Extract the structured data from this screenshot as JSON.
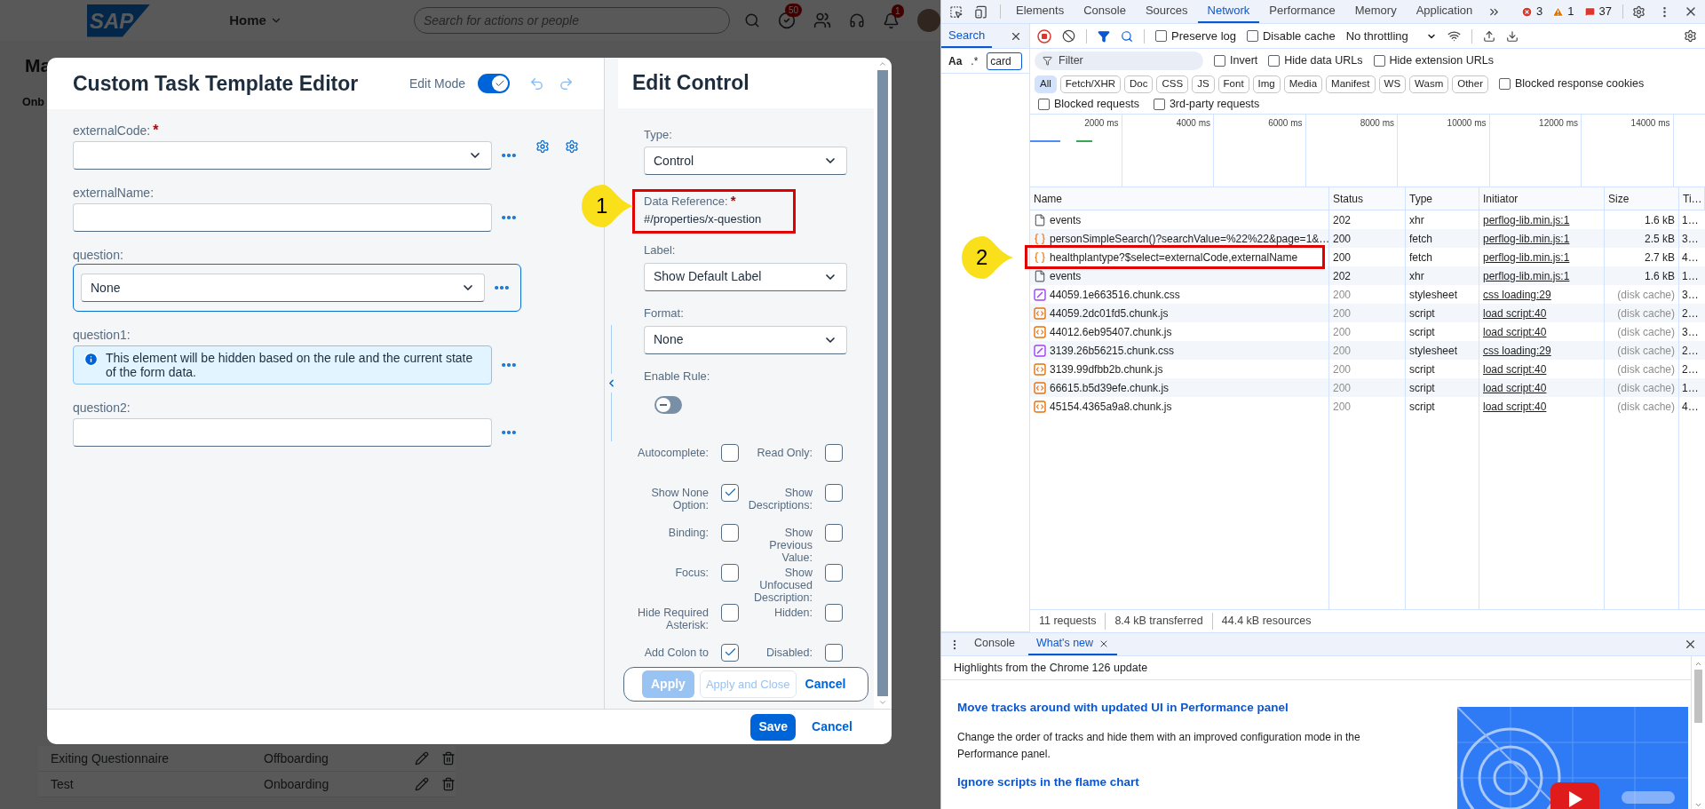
{
  "app": {
    "logo": "SAP",
    "nav": "Home",
    "search_placeholder": "Search for actions or people",
    "task_badge": "50",
    "bell_badge": "1",
    "title": "Ma",
    "tab": "Onb",
    "rows": [
      {
        "name": "Exiting Questionnaire",
        "type": "Offboarding"
      },
      {
        "name": "Test",
        "type": "Onboarding"
      }
    ]
  },
  "editor": {
    "title": "Custom Task Template Editor",
    "edit_mode_label": "Edit Mode",
    "edit_mode_on": true,
    "fields": [
      {
        "kind": "select",
        "label": "externalCode:",
        "required_mark": "*",
        "selected": false
      },
      {
        "kind": "input",
        "label": "externalName:",
        "selected": false
      },
      {
        "kind": "select",
        "label": "question:",
        "value": "None",
        "selected": true
      },
      {
        "kind": "info",
        "label": "question1:",
        "message": "This element will be hidden based on the rule and the current state of the form data.",
        "selected": false
      },
      {
        "kind": "input",
        "label": "question2:",
        "selected": false
      }
    ],
    "footer_buttons": [
      {
        "label": "Save",
        "kind": "primary"
      },
      {
        "label": "Cancel",
        "kind": "link"
      }
    ]
  },
  "edit_control": {
    "title": "Edit Control",
    "controls": [
      {
        "kind": "select",
        "label": "Type:",
        "value": "Control"
      },
      {
        "kind": "reference",
        "label": "Data Reference:",
        "required_mark": "*",
        "value": "#/properties/x-question",
        "callout": "1"
      },
      {
        "kind": "select",
        "label": "Label:",
        "value": "Show Default Label"
      },
      {
        "kind": "select",
        "label": "Format:",
        "value": "None"
      },
      {
        "kind": "toggle",
        "label": "Enable Rule:",
        "on": false
      }
    ],
    "options": [
      {
        "label": "Autocomplete:",
        "checked": false
      },
      {
        "label": "Read Only:",
        "checked": false
      },
      {
        "label": "Show None Option:",
        "checked": true
      },
      {
        "label": "Show Descriptions:",
        "checked": false
      },
      {
        "label": "Binding:",
        "checked": false
      },
      {
        "label": "Show Previous Value:",
        "checked": false
      },
      {
        "label": "Focus:",
        "checked": false
      },
      {
        "label": "Show Unfocused Description:",
        "checked": false
      },
      {
        "label": "Hide Required Asterisk:",
        "checked": false
      },
      {
        "label": "Hidden:",
        "checked": false
      },
      {
        "label": "Add Colon to",
        "checked": true
      },
      {
        "label": "Disabled:",
        "checked": false
      }
    ],
    "actions": [
      {
        "label": "Apply",
        "kind": "primary",
        "disabled": true
      },
      {
        "label": "Apply and Close",
        "kind": "secondary",
        "disabled": true
      },
      {
        "label": "Cancel",
        "kind": "link",
        "disabled": false
      }
    ]
  },
  "devtools": {
    "tabs": [
      {
        "label": "Elements",
        "selected": false
      },
      {
        "label": "Console",
        "selected": false
      },
      {
        "label": "Sources",
        "selected": false
      },
      {
        "label": "Network",
        "selected": true
      },
      {
        "label": "Performance",
        "selected": false
      },
      {
        "label": "Memory",
        "selected": false
      },
      {
        "label": "Application",
        "selected": false
      }
    ],
    "errors": "3",
    "warnings": "1",
    "issues": "37",
    "search_panel": {
      "tab": "Search",
      "case_toggle": "Aa",
      "regex_toggle": ".*",
      "query": "card"
    },
    "toolbar": {
      "checkboxes": [
        {
          "label": "Preserve log",
          "checked": false
        },
        {
          "label": "Disable cache",
          "checked": false
        }
      ],
      "throttling": "No throttling"
    },
    "filter": {
      "placeholder": "Filter",
      "checkboxes": [
        {
          "label": "Invert",
          "checked": false
        },
        {
          "label": "Hide data URLs",
          "checked": false
        },
        {
          "label": "Hide extension URLs",
          "checked": false
        }
      ]
    },
    "type_filters": [
      {
        "label": "All",
        "selected": true
      },
      {
        "label": "Fetch/XHR",
        "selected": false
      },
      {
        "label": "Doc",
        "selected": false
      },
      {
        "label": "CSS",
        "selected": false
      },
      {
        "label": "JS",
        "selected": false
      },
      {
        "label": "Font",
        "selected": false
      },
      {
        "label": "Img",
        "selected": false
      },
      {
        "label": "Media",
        "selected": false
      },
      {
        "label": "Manifest",
        "selected": false
      },
      {
        "label": "WS",
        "selected": false
      },
      {
        "label": "Wasm",
        "selected": false
      },
      {
        "label": "Other",
        "selected": false
      }
    ],
    "blocked_cookies": {
      "label": "Blocked response cookies",
      "checked": false
    },
    "extra_checkboxes": [
      {
        "label": "Blocked requests",
        "checked": false
      },
      {
        "label": "3rd-party requests",
        "checked": false
      }
    ],
    "overview_ticks": [
      "2000 ms",
      "4000 ms",
      "6000 ms",
      "8000 ms",
      "10000 ms",
      "12000 ms",
      "14000 ms"
    ],
    "columns": [
      "Name",
      "Status",
      "Type",
      "Initiator",
      "Size",
      "Ti…"
    ],
    "rows": [
      {
        "kind": "doc",
        "name": "events",
        "status": "202",
        "type": "xhr",
        "initiator": "perflog-lib.min.js:1",
        "size": "1.6 kB",
        "time": "1…",
        "cached": false
      },
      {
        "kind": "fetch",
        "name": "personSimpleSearch()?searchValue=%22%22&page=1&…",
        "status": "200",
        "type": "fetch",
        "initiator": "perflog-lib.min.js:1",
        "size": "2.5 kB",
        "time": "3…",
        "cached": false
      },
      {
        "kind": "fetch",
        "name": "healthplantype?$select=externalCode,externalName",
        "status": "200",
        "type": "fetch",
        "initiator": "perflog-lib.min.js:1",
        "size": "2.7 kB",
        "time": "4…",
        "cached": false,
        "callout": "2"
      },
      {
        "kind": "doc",
        "name": "events",
        "status": "202",
        "type": "xhr",
        "initiator": "perflog-lib.min.js:1",
        "size": "1.6 kB",
        "time": "1…",
        "cached": false
      },
      {
        "kind": "css",
        "name": "44059.1e663516.chunk.css",
        "status": "200",
        "type": "stylesheet",
        "initiator": "css loading:29",
        "size": "(disk cache)",
        "time": "3…",
        "cached": true
      },
      {
        "kind": "script",
        "name": "44059.2dc01fd5.chunk.js",
        "status": "200",
        "type": "script",
        "initiator": "load script:40",
        "size": "(disk cache)",
        "time": "2…",
        "cached": true
      },
      {
        "kind": "script",
        "name": "44012.6eb95407.chunk.js",
        "status": "200",
        "type": "script",
        "initiator": "load script:40",
        "size": "(disk cache)",
        "time": "3…",
        "cached": true
      },
      {
        "kind": "css",
        "name": "3139.26b56215.chunk.css",
        "status": "200",
        "type": "stylesheet",
        "initiator": "css loading:29",
        "size": "(disk cache)",
        "time": "2…",
        "cached": true
      },
      {
        "kind": "script",
        "name": "3139.99dfbb2b.chunk.js",
        "status": "200",
        "type": "script",
        "initiator": "load script:40",
        "size": "(disk cache)",
        "time": "2…",
        "cached": true
      },
      {
        "kind": "script",
        "name": "66615.b5d39efe.chunk.js",
        "status": "200",
        "type": "script",
        "initiator": "load script:40",
        "size": "(disk cache)",
        "time": "1…",
        "cached": true
      },
      {
        "kind": "script",
        "name": "45154.4365a9a8.chunk.js",
        "status": "200",
        "type": "script",
        "initiator": "load script:40",
        "size": "(disk cache)",
        "time": "4…",
        "cached": true
      }
    ],
    "summary": [
      "11 requests",
      "8.4 kB transferred",
      "44.4 kB resources"
    ],
    "drawer": {
      "tabs": [
        {
          "label": "Console",
          "selected": false,
          "closable": false
        },
        {
          "label": "What's new",
          "selected": true,
          "closable": true
        }
      ],
      "subtitle": "Highlights from the Chrome 126 update",
      "articles": [
        {
          "kind": "heading",
          "text": "Move tracks around with updated UI in Performance panel"
        },
        {
          "kind": "paragraph",
          "text": "Change the order of tracks and hide them with an improved configuration mode in the Performance panel."
        },
        {
          "kind": "heading",
          "text": "Ignore scripts in the flame chart"
        }
      ]
    }
  }
}
